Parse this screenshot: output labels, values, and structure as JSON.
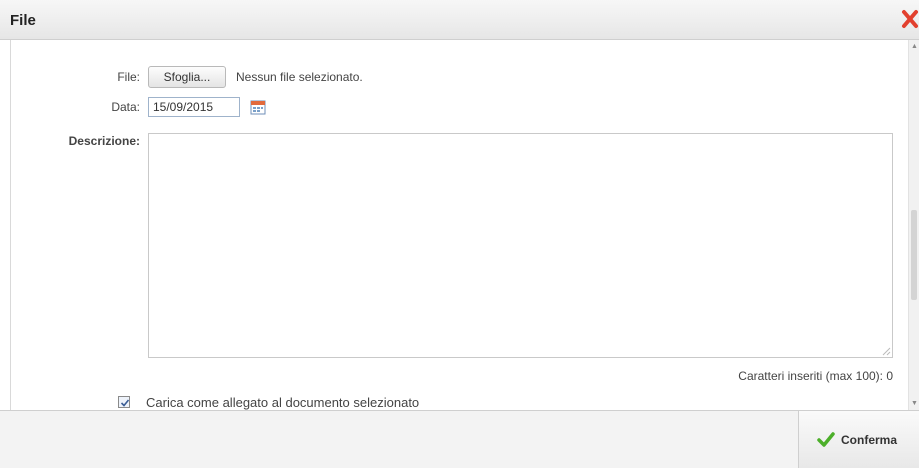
{
  "dialog": {
    "title": "File"
  },
  "form": {
    "file_label": "File:",
    "browse_label": "Sfoglia...",
    "no_file_text": "Nessun file selezionato.",
    "date_label": "Data:",
    "date_value": "15/09/2015",
    "description_label": "Descrizione:",
    "description_value": "",
    "char_counter": "Caratteri inseriti (max 100): 0",
    "attach_checkbox_label": "Carica come allegato al documento selezionato",
    "attach_checked": true
  },
  "footer": {
    "confirm_label": "Conferma"
  },
  "icons": {
    "close": "close-x-icon",
    "calendar": "calendar-icon",
    "confirm": "checkmark-icon"
  },
  "colors": {
    "close_red": "#e2402e",
    "confirm_green": "#4caf2a"
  }
}
